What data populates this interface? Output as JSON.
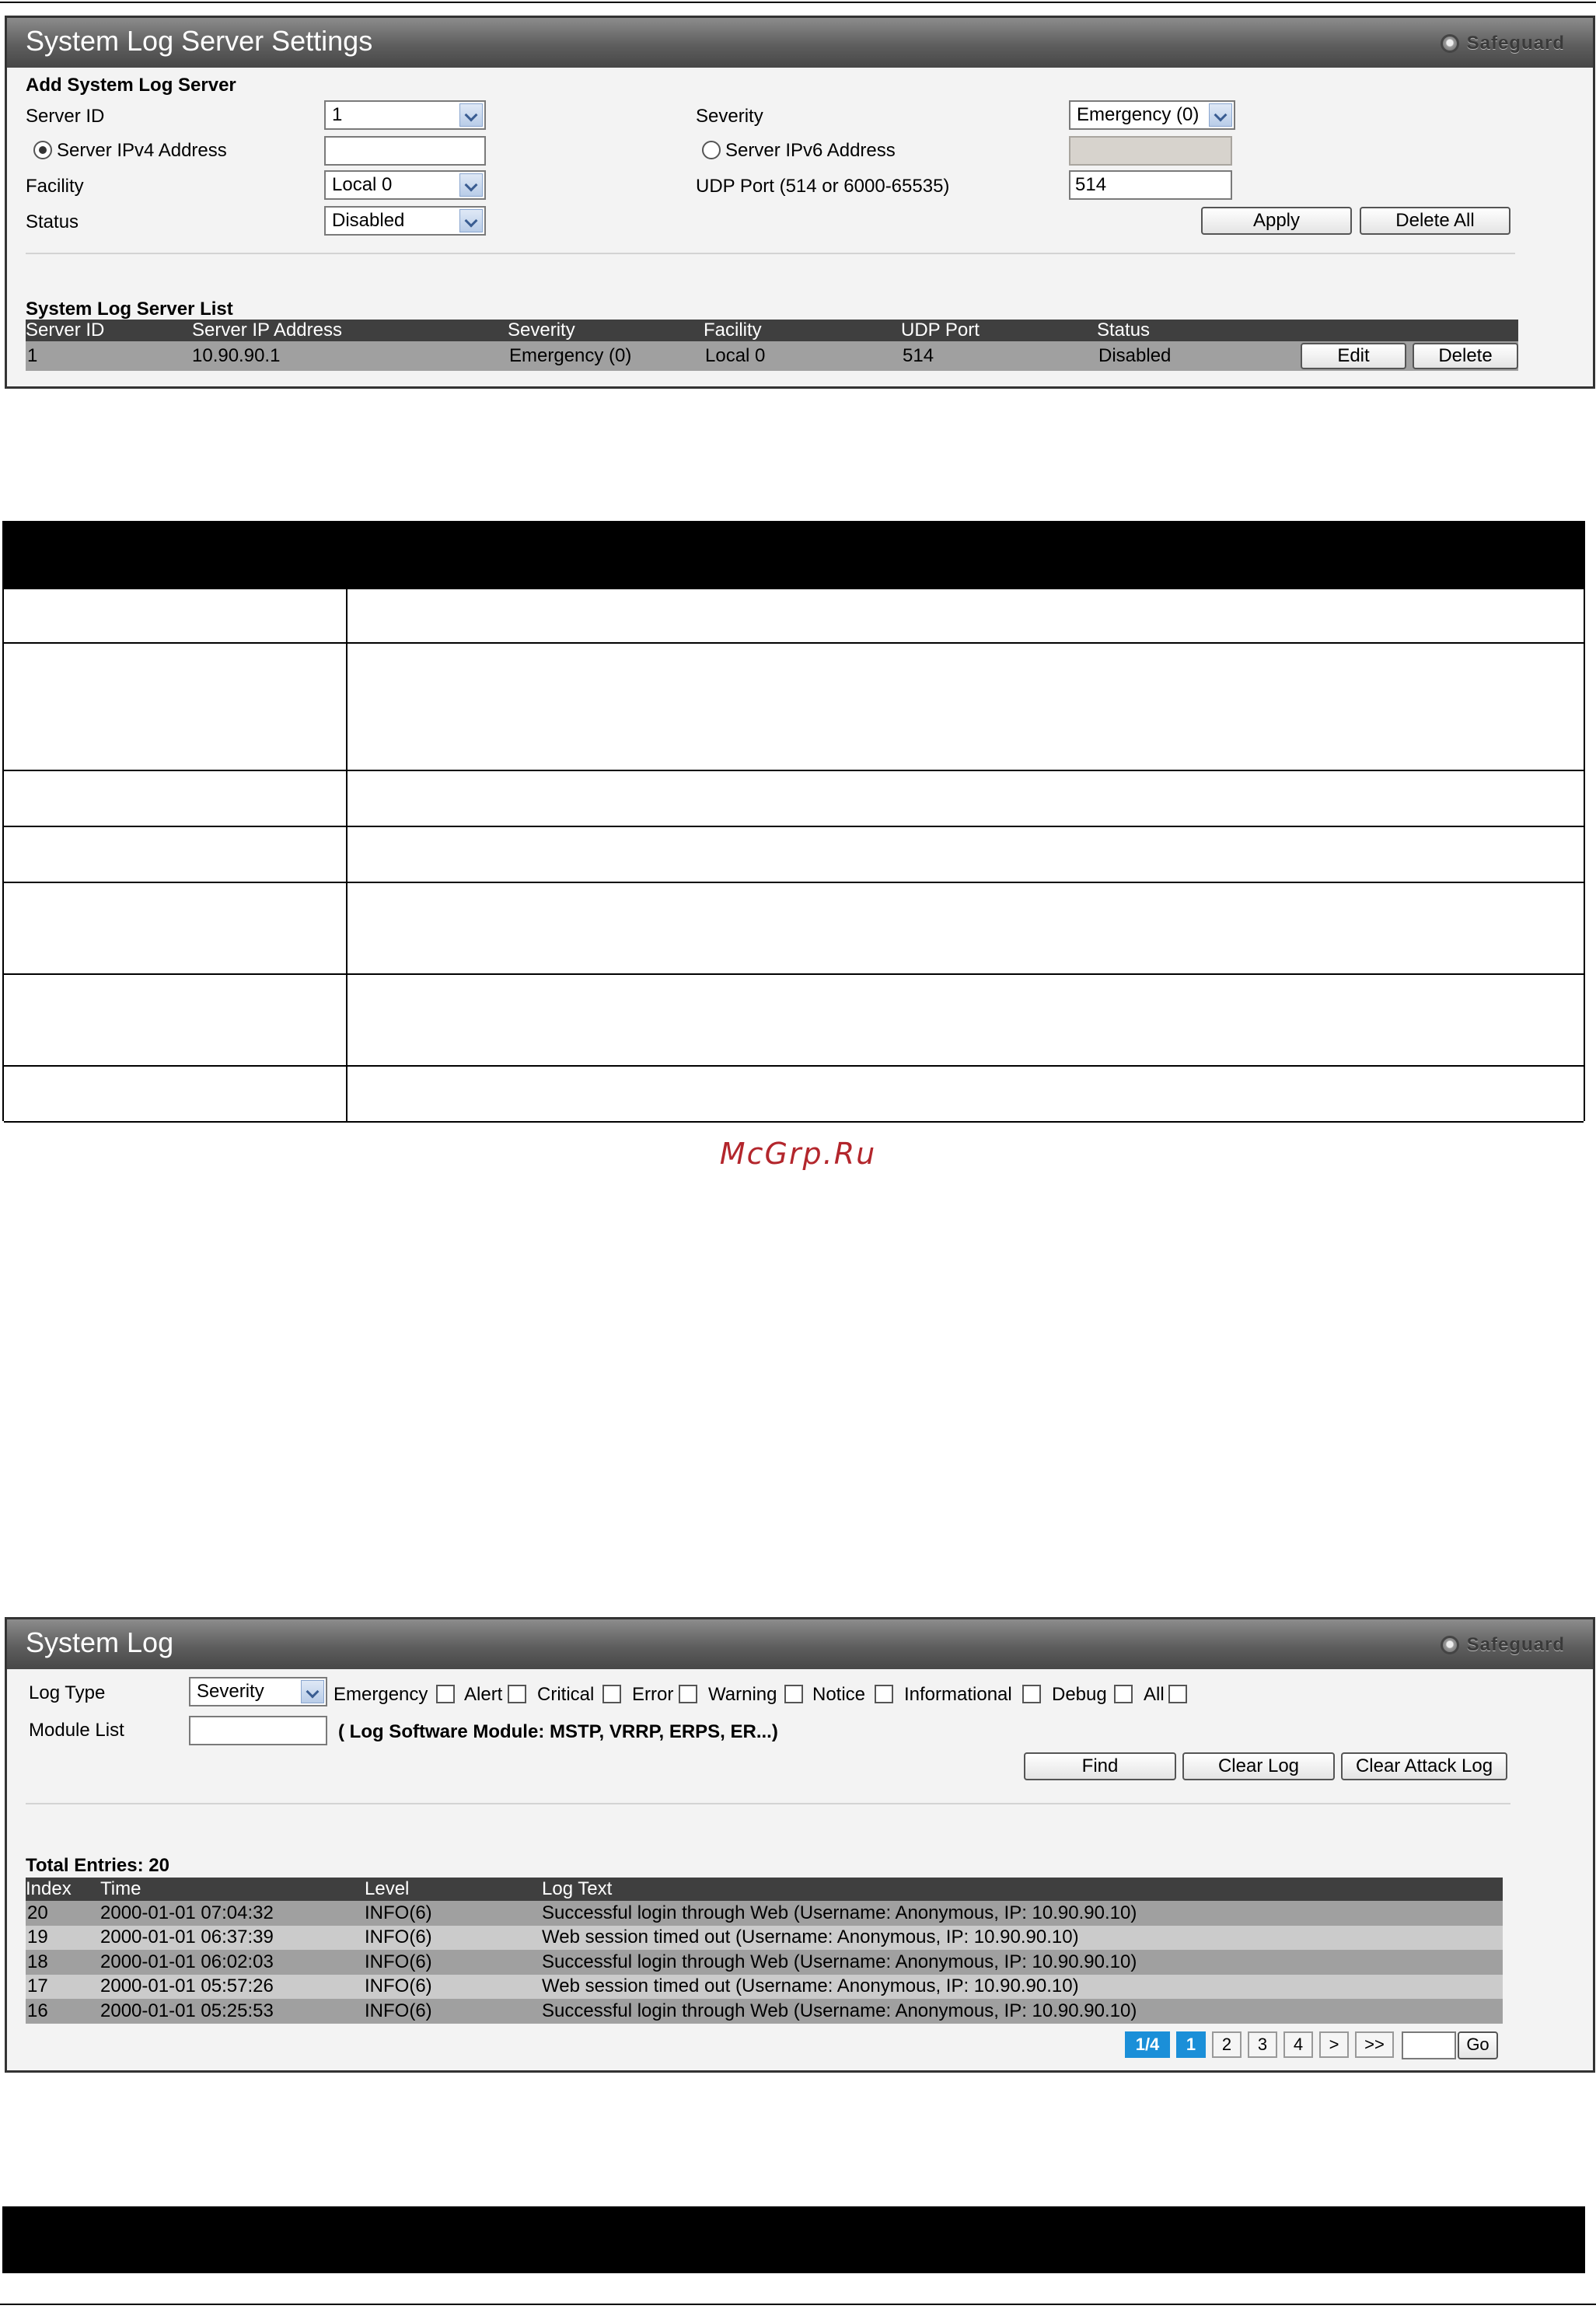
{
  "sg_label": "Safeguard",
  "syslog_server": {
    "title": "System Log Server Settings",
    "add_section": "Add System Log Server",
    "server_id_label": "Server ID",
    "server_id_value": "1",
    "severity_label": "Severity",
    "severity_value": "Emergency (0)",
    "ipv4_label": "Server IPv4 Address",
    "ipv4_value": "",
    "ipv6_label": "Server IPv6 Address",
    "ipv6_value": "",
    "facility_label": "Facility",
    "facility_value": "Local 0",
    "udp_label": "UDP Port  (514 or 6000-65535)",
    "udp_value": "514",
    "status_label": "Status",
    "status_value": "Disabled",
    "apply_label": "Apply",
    "delete_all_label": "Delete All",
    "list_section": "System Log Server List",
    "columns": [
      "Server ID",
      "Server IP Address",
      "Severity",
      "Facility",
      "UDP Port",
      "Status"
    ],
    "rows": [
      {
        "id": "1",
        "ip": "10.90.90.1",
        "severity": "Emergency (0)",
        "facility": "Local 0",
        "udp": "514",
        "status": "Disabled"
      }
    ],
    "edit_label": "Edit",
    "delete_label": "Delete"
  },
  "watermark": "McGrp.Ru",
  "system_log": {
    "title": "System Log",
    "log_type_label": "Log Type",
    "log_type_value": "Severity",
    "levels": [
      "Emergency",
      "Alert",
      "Critical",
      "Error",
      "Warning",
      "Notice",
      "Informational",
      "Debug",
      "All"
    ],
    "module_label": "Module List",
    "module_value": "",
    "module_hint": "( Log Software Module: MSTP, VRRP, ERPS, ER...)",
    "find_label": "Find",
    "clear_log_label": "Clear Log",
    "clear_attack_label": "Clear Attack Log",
    "total_entries": "Total Entries: 20",
    "columns": [
      "Index",
      "Time",
      "Level",
      "Log Text"
    ],
    "rows": [
      {
        "index": "20",
        "time": "2000-01-01 07:04:32",
        "level": "INFO(6)",
        "text": "Successful login through Web (Username: Anonymous, IP: 10.90.90.10)"
      },
      {
        "index": "19",
        "time": "2000-01-01 06:37:39",
        "level": "INFO(6)",
        "text": "Web session timed out (Username: Anonymous, IP: 10.90.90.10)"
      },
      {
        "index": "18",
        "time": "2000-01-01 06:02:03",
        "level": "INFO(6)",
        "text": "Successful login through Web (Username: Anonymous, IP: 10.90.90.10)"
      },
      {
        "index": "17",
        "time": "2000-01-01 05:57:26",
        "level": "INFO(6)",
        "text": "Web session timed out (Username: Anonymous, IP: 10.90.90.10)"
      },
      {
        "index": "16",
        "time": "2000-01-01 05:25:53",
        "level": "INFO(6)",
        "text": "Successful login through Web (Username: Anonymous, IP: 10.90.90.10)"
      }
    ],
    "pager": {
      "current": "1/4",
      "pages": [
        "1",
        "2",
        "3",
        "4"
      ],
      "next": ">",
      "last": ">>",
      "go_label": "Go",
      "page_input": ""
    }
  }
}
